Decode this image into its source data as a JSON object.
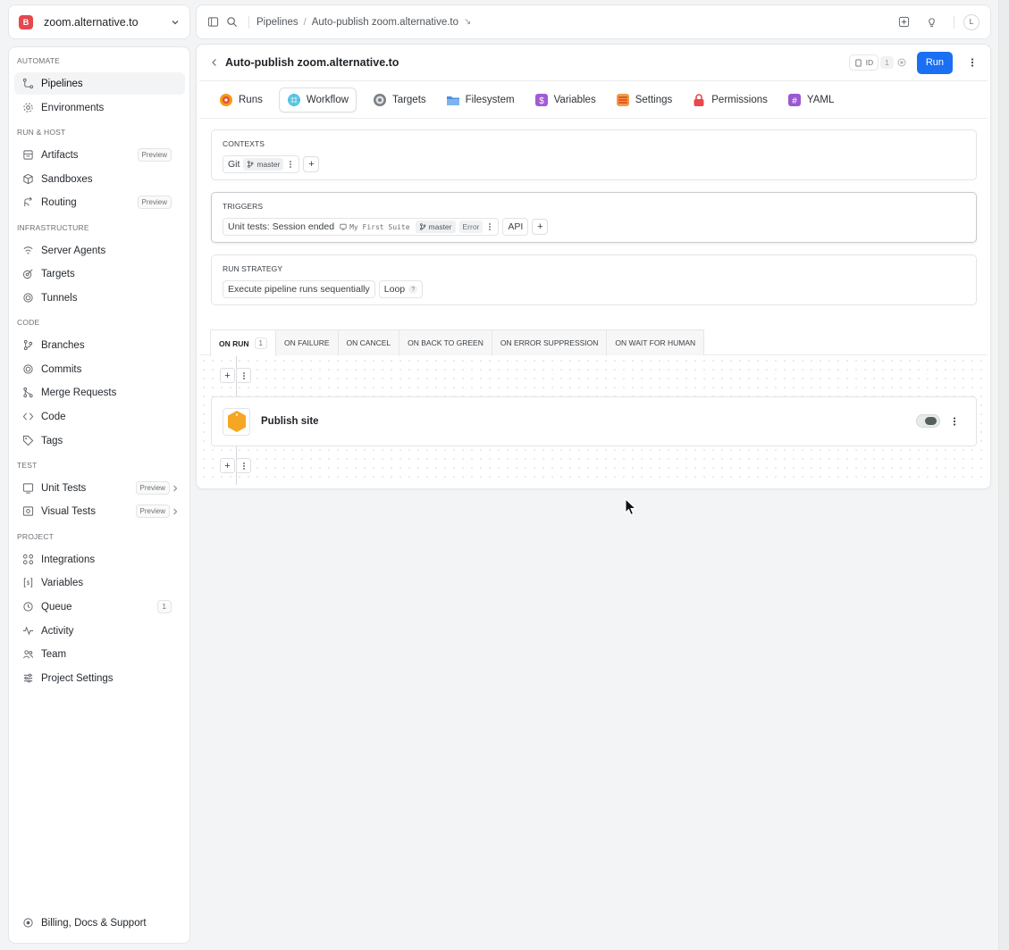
{
  "project": {
    "avatar_letter": "B",
    "name": "zoom.alternative.to",
    "avatar_color": "#e5484d"
  },
  "sidebar": {
    "sections": {
      "automate": "AUTOMATE",
      "run_host": "RUN & HOST",
      "infrastructure": "INFRASTRUCTURE",
      "code": "CODE",
      "test": "TEST",
      "project": "PROJECT"
    },
    "items": {
      "pipelines": "Pipelines",
      "environments": "Environments",
      "artifacts": "Artifacts",
      "sandboxes": "Sandboxes",
      "routing": "Routing",
      "server_agents": "Server Agents",
      "targets": "Targets",
      "tunnels": "Tunnels",
      "branches": "Branches",
      "commits": "Commits",
      "merge_requests": "Merge Requests",
      "code": "Code",
      "tags": "Tags",
      "unit_tests": "Unit Tests",
      "visual_tests": "Visual Tests",
      "integrations": "Integrations",
      "variables": "Variables",
      "queue": "Queue",
      "activity": "Activity",
      "team": "Team",
      "project_settings": "Project Settings"
    },
    "preview_badge": "Preview",
    "queue_count": "1",
    "billing": "Billing, Docs & Support"
  },
  "topbar": {
    "breadcrumb_1": "Pipelines",
    "breadcrumb_sep": "/",
    "breadcrumb_2": "Auto-publish zoom.alternative.to",
    "breadcrumb_arrow": "↘",
    "user_initial": "L"
  },
  "pipeline": {
    "title": "Auto-publish zoom.alternative.to",
    "id_label": "ID",
    "id_value": "1",
    "run_label": "Run",
    "run_color": "#1a6ff2"
  },
  "tabs": {
    "runs": "Runs",
    "workflow": "Workflow",
    "targets": "Targets",
    "filesystem": "Filesystem",
    "variables": "Variables",
    "settings": "Settings",
    "permissions": "Permissions",
    "yaml": "YAML"
  },
  "contexts": {
    "title": "CONTEXTS",
    "git_label": "Git",
    "branch": "master",
    "add": "+"
  },
  "triggers": {
    "title": "TRIGGERS",
    "trigger_label": "Unit tests: Session ended",
    "suite": "My First Suite",
    "branch": "master",
    "status": "Error",
    "api_label": "API",
    "add": "+"
  },
  "run_strategy": {
    "title": "RUN STRATEGY",
    "strategy": "Execute pipeline runs sequentially",
    "loop_label": "Loop",
    "loop_help": "?"
  },
  "event_tabs": {
    "on_run": "ON RUN",
    "on_run_count": "1",
    "on_failure": "ON FAILURE",
    "on_cancel": "ON CANCEL",
    "on_back_to_green": "ON BACK TO GREEN",
    "on_error_suppression": "ON ERROR SUPPRESSION",
    "on_wait_for_human": "ON WAIT FOR HUMAN"
  },
  "steps": [
    {
      "name": "Publish site",
      "enabled": true,
      "icon": "hexagon-icon",
      "icon_color": "#f5a623"
    }
  ],
  "add_symbol": "+"
}
